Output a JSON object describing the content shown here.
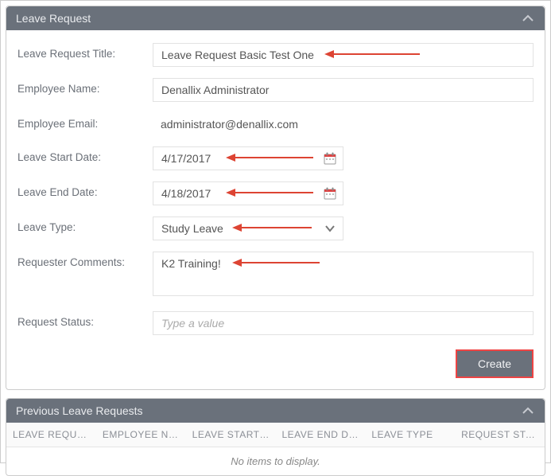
{
  "panel1": {
    "title": "Leave Request"
  },
  "form": {
    "title": {
      "label": "Leave Request Title:",
      "value": "Leave Request Basic Test One"
    },
    "employee_name": {
      "label": "Employee Name:",
      "value": "Denallix Administrator"
    },
    "employee_email": {
      "label": "Employee Email:",
      "value": "administrator@denallix.com"
    },
    "start_date": {
      "label": "Leave Start Date:",
      "value": "4/17/2017"
    },
    "end_date": {
      "label": "Leave End Date:",
      "value": "4/18/2017"
    },
    "leave_type": {
      "label": "Leave Type:",
      "value": "Study Leave"
    },
    "comments": {
      "label": "Requester Comments:",
      "value": "K2 Training!"
    },
    "status": {
      "label": "Request Status:",
      "value": "",
      "placeholder": "Type a value"
    },
    "create_label": "Create"
  },
  "panel2": {
    "title": "Previous Leave Requests",
    "columns": [
      "LEAVE REQUE…",
      "EMPLOYEE N…",
      "LEAVE START …",
      "LEAVE END D…",
      "LEAVE TYPE",
      "REQUEST STA…"
    ],
    "empty_text": "No items to display."
  }
}
